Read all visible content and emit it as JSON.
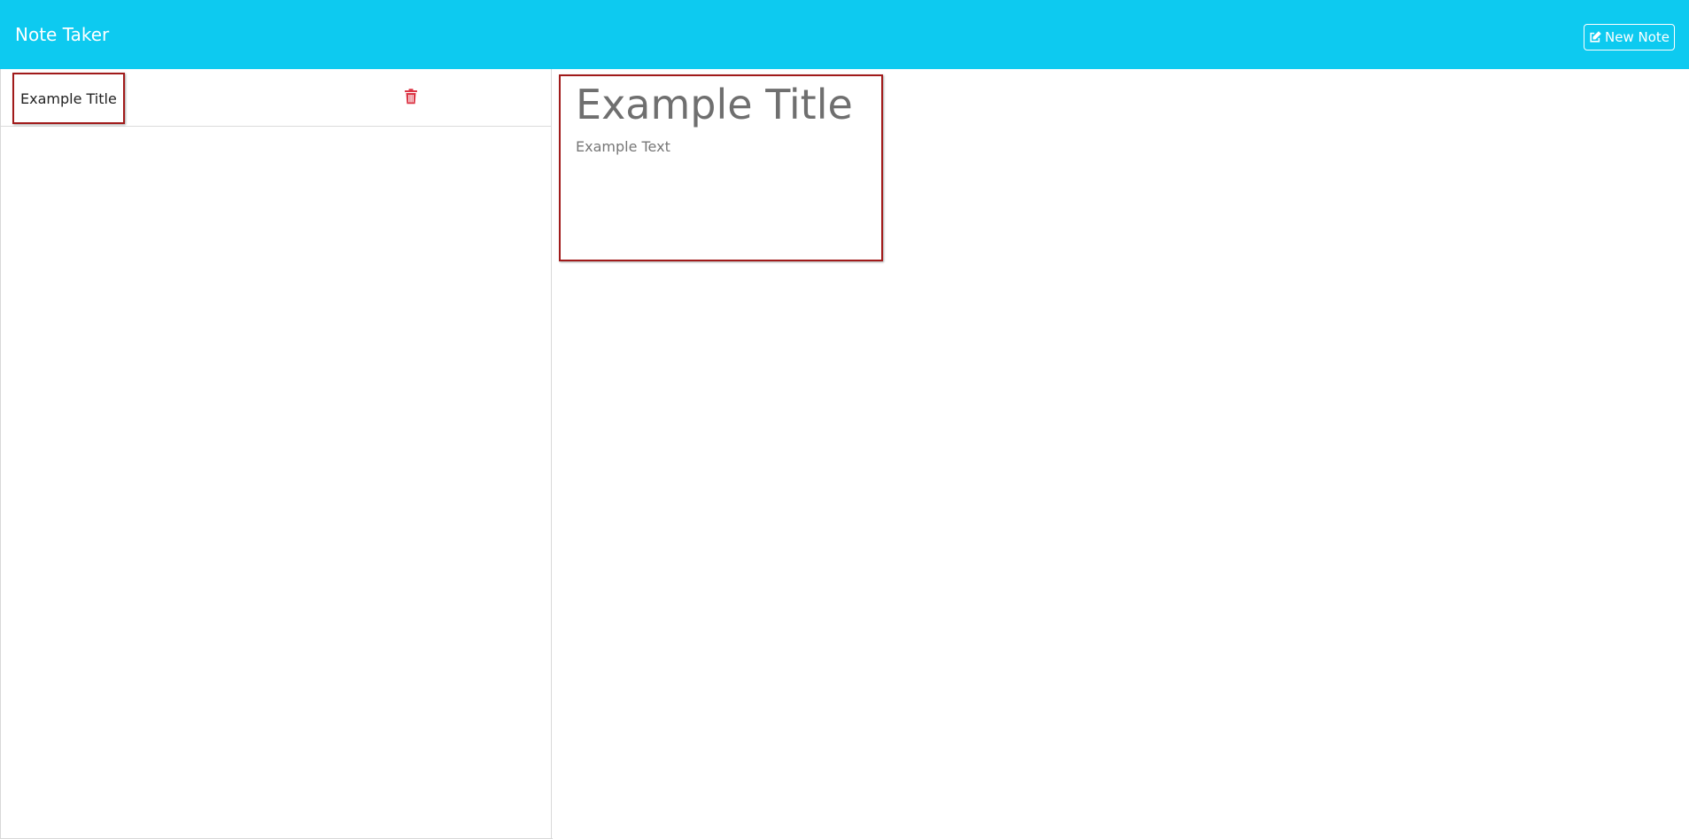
{
  "app": {
    "title": "Note Taker"
  },
  "header": {
    "new_note_label": "New Note",
    "new_note_icon": "edit-icon",
    "background_color": "#0dcaf0",
    "text_color": "#ffffff"
  },
  "notes_list": {
    "items": [
      {
        "title": "Example Title",
        "delete_icon": "trash-icon",
        "delete_color": "#dc3545"
      }
    ]
  },
  "editor": {
    "title": "Example Title",
    "text": "Example Text",
    "border_color": "#a11a1a"
  }
}
